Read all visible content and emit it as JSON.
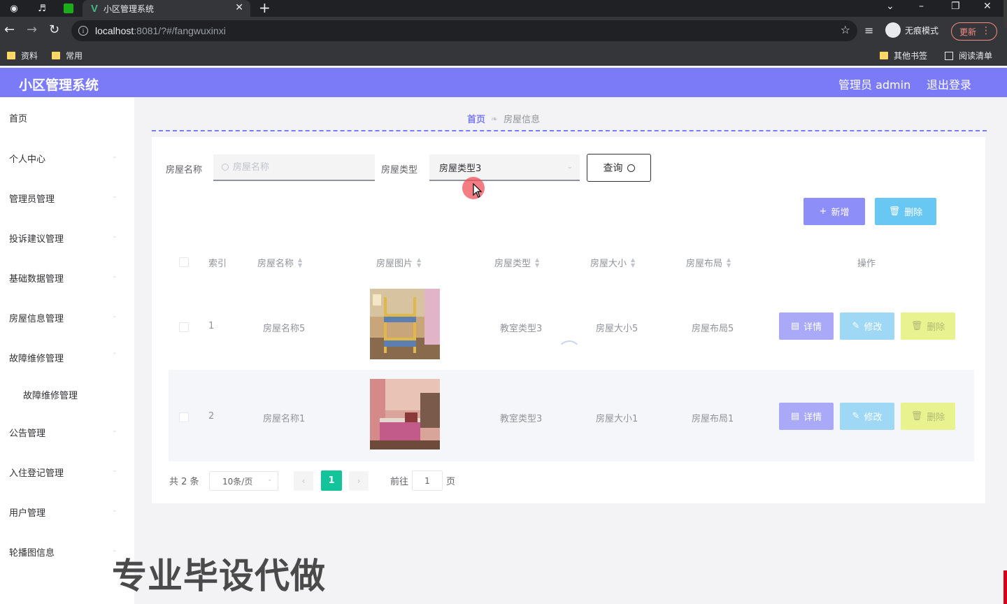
{
  "browser": {
    "tab_title": "小区管理系统",
    "url_host": "localhost",
    "url_rest": ":8081/?#/fangwuxinxi",
    "incognito_label": "无痕模式",
    "update_label": "更新",
    "bookmarks": [
      "资料",
      "常用"
    ],
    "other_bookmarks": "其他书签",
    "reading_list": "阅读清单"
  },
  "header": {
    "title": "小区管理系统",
    "admin_label": "管理员 admin",
    "logout": "退出登录",
    "color": "#7b7bf7"
  },
  "sidebar": {
    "items": [
      {
        "label": "首页"
      },
      {
        "label": "个人中心"
      },
      {
        "label": "管理员管理"
      },
      {
        "label": "投诉建议管理"
      },
      {
        "label": "基础数据管理"
      },
      {
        "label": "房屋信息管理"
      },
      {
        "label": "故障维修管理"
      },
      {
        "label": "故障维修管理"
      },
      {
        "label": "公告管理"
      },
      {
        "label": "入住登记管理"
      },
      {
        "label": "用户管理"
      },
      {
        "label": "轮播图信息"
      }
    ]
  },
  "breadcrumb": {
    "home": "首页",
    "current": "房屋信息"
  },
  "search": {
    "name_label": "房屋名称",
    "name_placeholder": "房屋名称",
    "type_label": "房屋类型",
    "type_value": "房屋类型3",
    "query_button": "查询"
  },
  "actions": {
    "add": "新增",
    "delete": "删除"
  },
  "table": {
    "headers": [
      "索引",
      "房屋名称",
      "房屋图片",
      "房屋类型",
      "房屋大小",
      "房屋布局",
      "操作"
    ],
    "rows": [
      {
        "index": "1",
        "name": "房屋名称5",
        "type": "教室类型3",
        "size": "房屋大小5",
        "layout": "房屋布局5"
      },
      {
        "index": "2",
        "name": "房屋名称1",
        "type": "教室类型3",
        "size": "房屋大小1",
        "layout": "房屋布局1"
      }
    ],
    "op_detail": "详情",
    "op_edit": "修改",
    "op_delete": "删除"
  },
  "pagination": {
    "total_text": "共 2 条",
    "page_size": "10条/页",
    "current_page": "1",
    "goto_label": "前往",
    "goto_value": "1",
    "page_suffix": "页"
  },
  "watermark": "专业毕设代做",
  "colors": {
    "accent": "#7b7bf7",
    "edit": "#9ed8f5",
    "delete": "#e8f38f",
    "page_active": "#13c49a"
  }
}
